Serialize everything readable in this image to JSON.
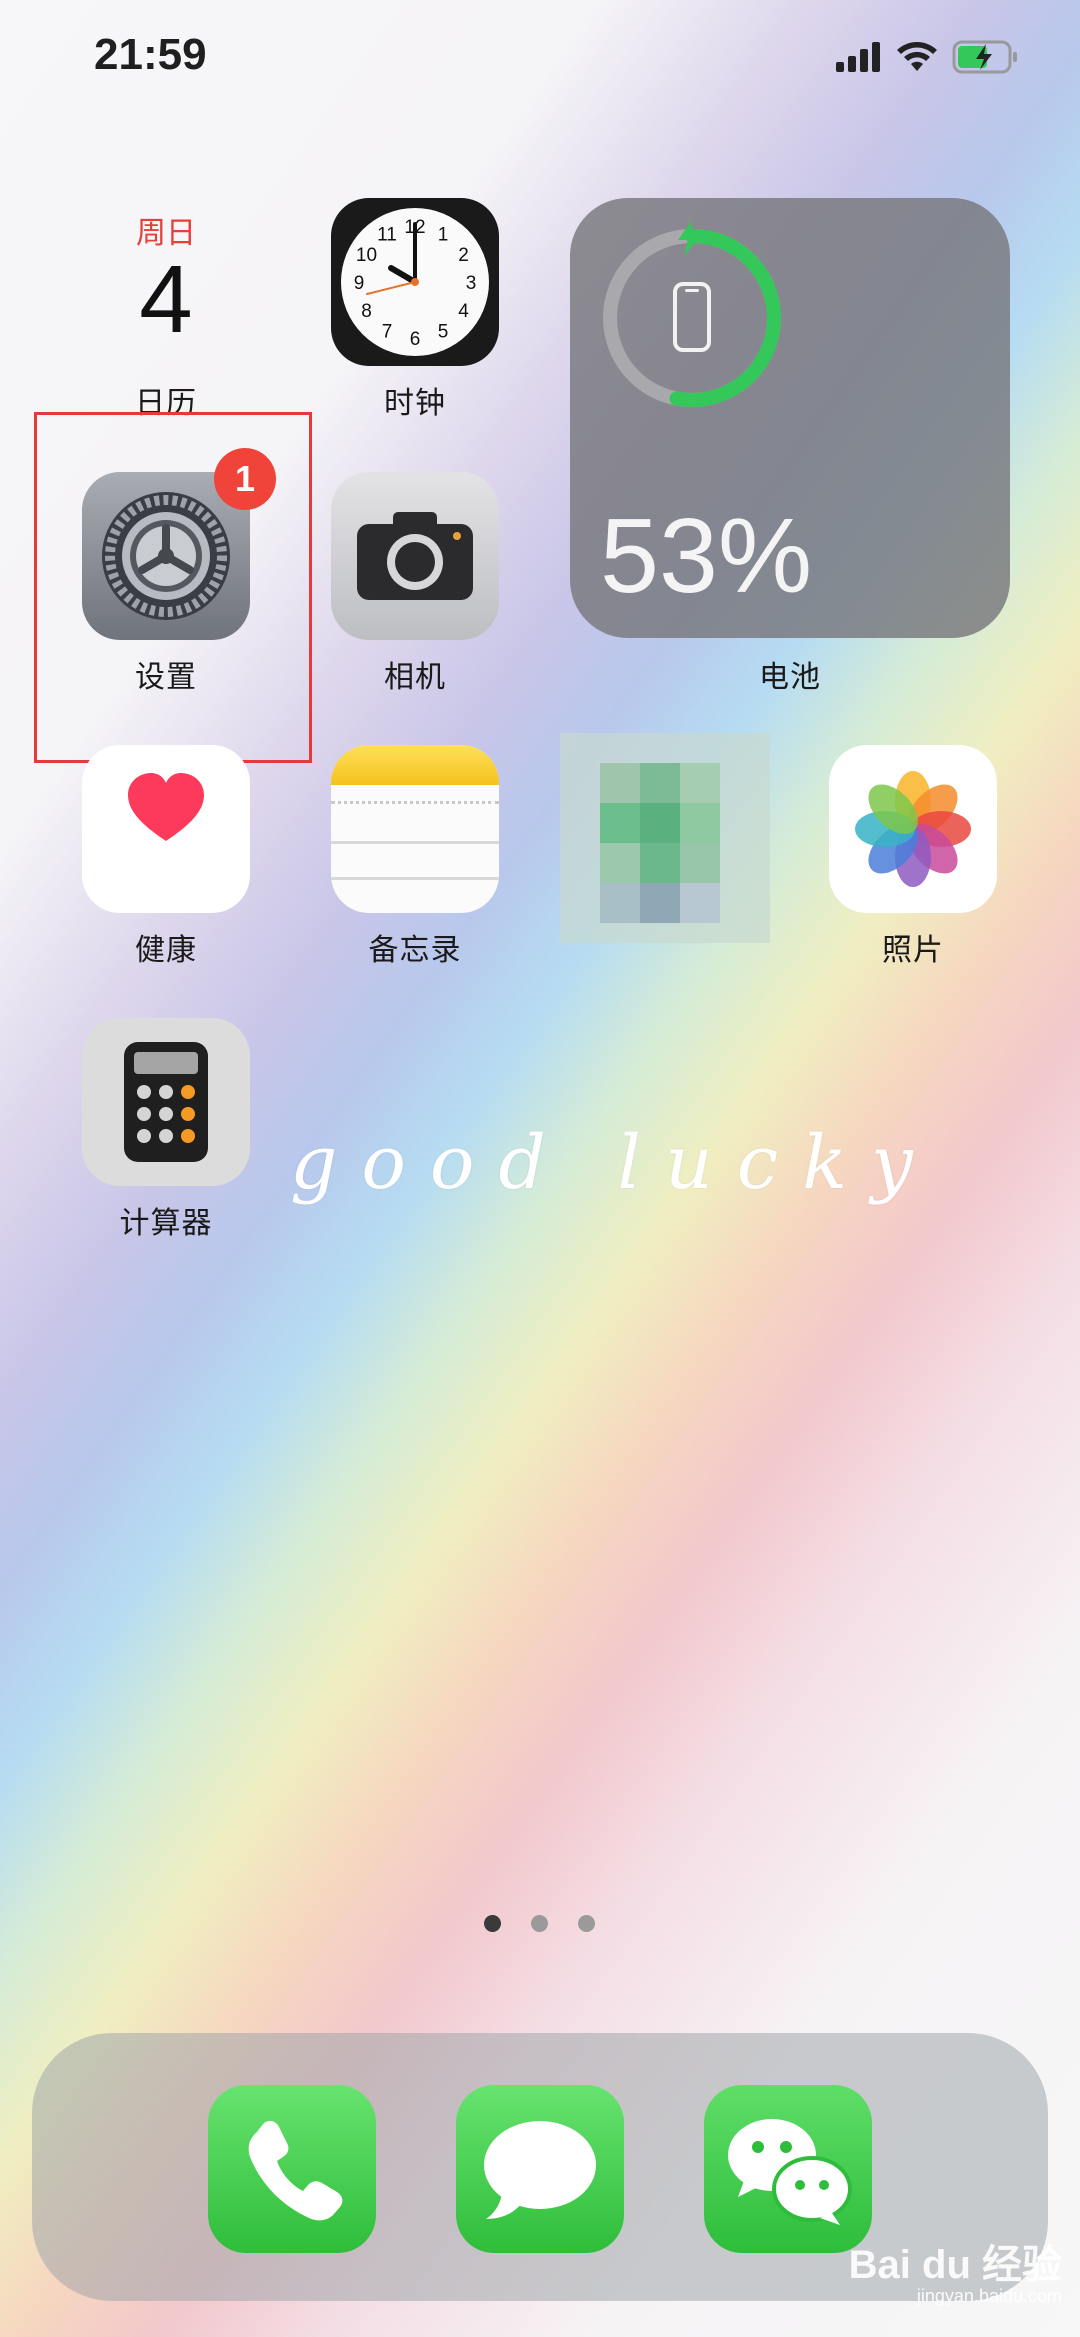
{
  "status_bar": {
    "time": "21:59"
  },
  "calendar": {
    "weekday": "周日",
    "day": "4",
    "label": "日历"
  },
  "clock": {
    "label": "时钟",
    "numbers": [
      "12",
      "1",
      "2",
      "3",
      "4",
      "5",
      "6",
      "7",
      "8",
      "9",
      "10",
      "11"
    ]
  },
  "battery_widget": {
    "percent": "53%",
    "label": "电池",
    "level": 0.53
  },
  "apps": {
    "settings": {
      "label": "设置",
      "badge": "1"
    },
    "camera": {
      "label": "相机"
    },
    "health": {
      "label": "健康"
    },
    "notes": {
      "label": "备忘录"
    },
    "photos": {
      "label": "照片"
    },
    "calculator": {
      "label": "计算器"
    }
  },
  "wallpaper_text": "good  lucky",
  "page_indicator": {
    "pages": 3,
    "active": 1
  },
  "dock": {
    "apps": [
      "phone-icon",
      "messages-icon",
      "wechat-icon"
    ]
  },
  "watermark": {
    "brand": "Bai du 经验",
    "url": "jingyan.baidu.com"
  },
  "colors": {
    "highlight": "#e23b3b",
    "badge": "#f0433a",
    "battery_green": "#34c759"
  }
}
